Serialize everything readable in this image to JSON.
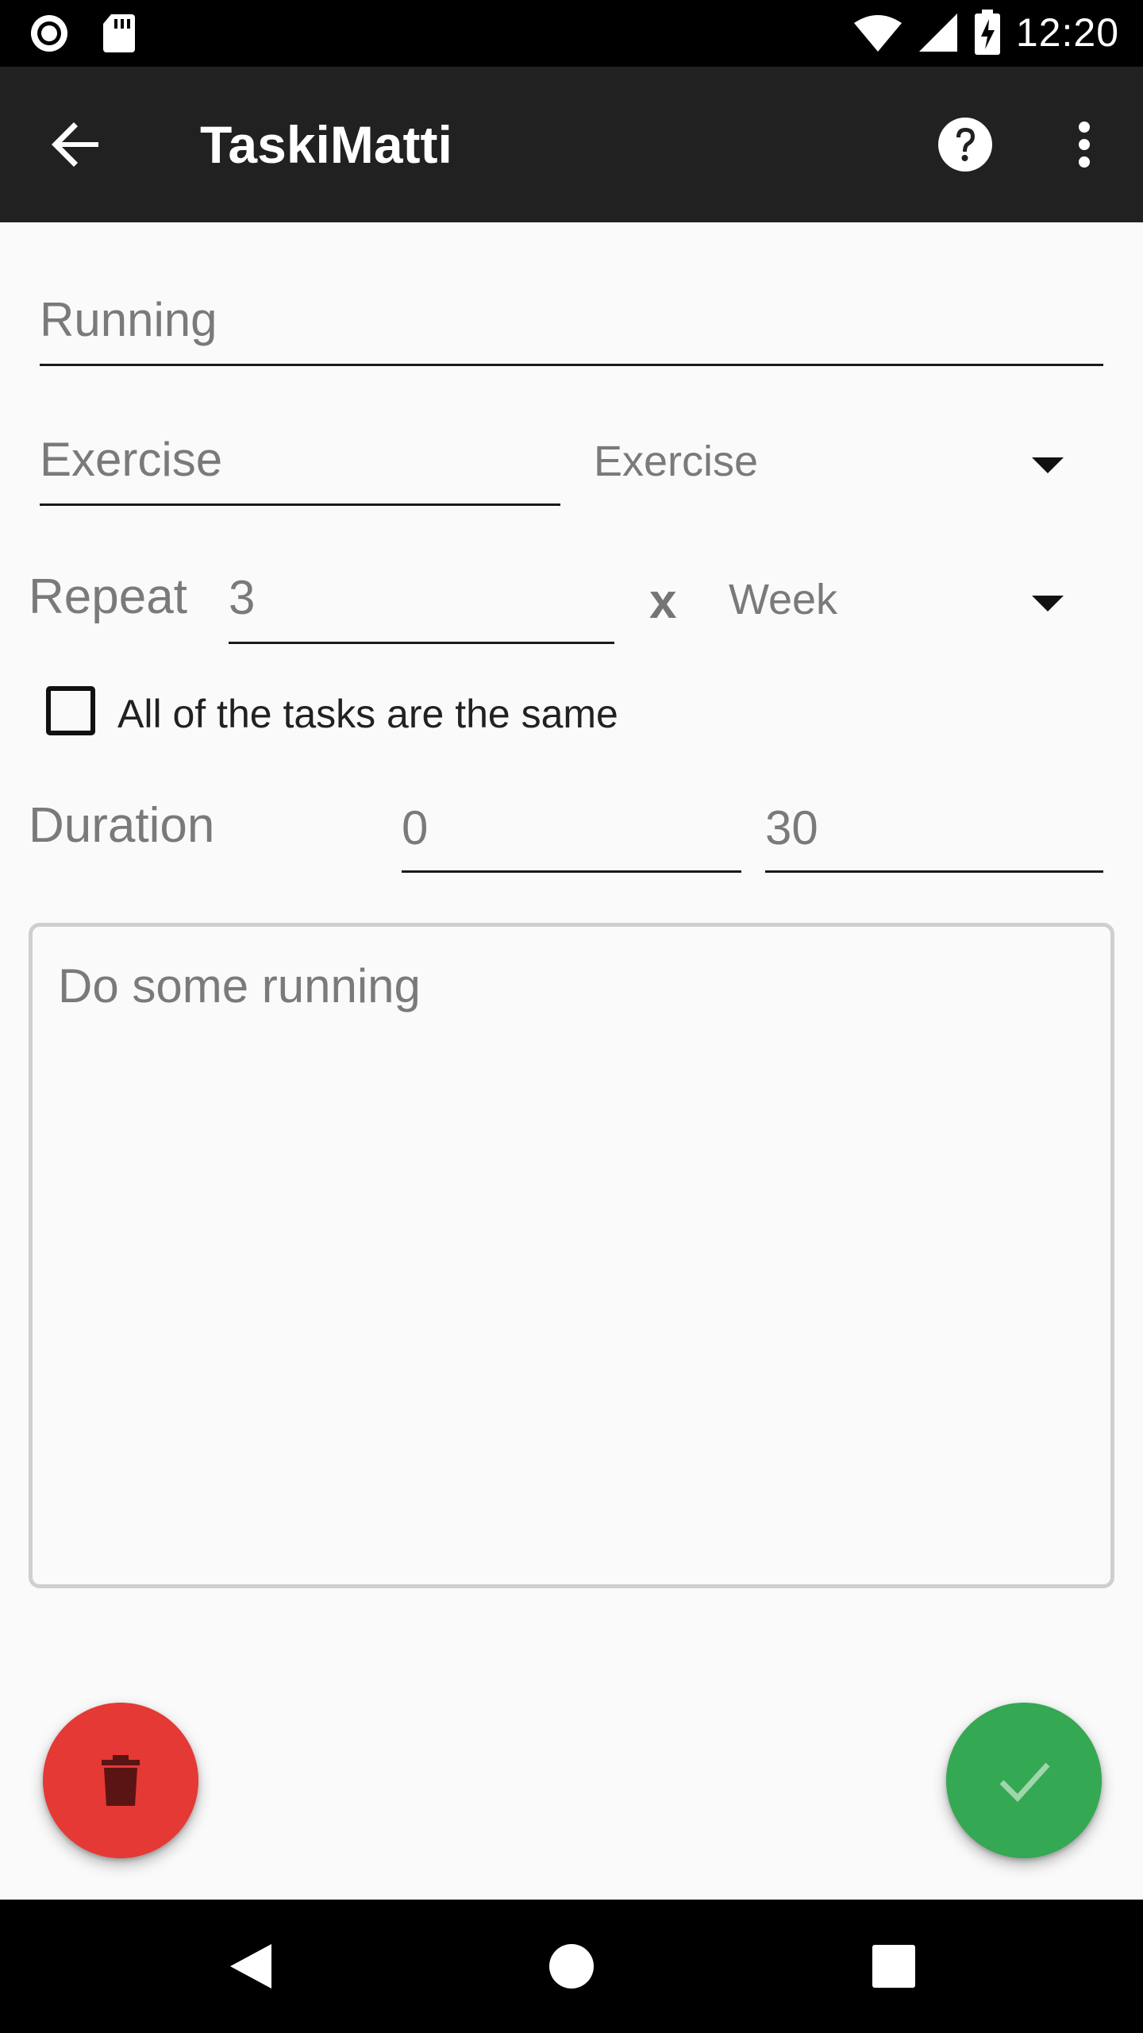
{
  "status_bar": {
    "time": "12:20",
    "icons": [
      "record-icon",
      "sd-card-icon",
      "wifi-icon",
      "signal-icon",
      "battery-charging-icon"
    ]
  },
  "app_bar": {
    "title": "TaskiMatti",
    "back_icon": "arrow-back-icon",
    "help_icon": "help-icon",
    "more_icon": "more-vert-icon"
  },
  "form": {
    "name": {
      "value": "Running"
    },
    "category": {
      "value": "Exercise"
    },
    "category_select": {
      "selected": "Exercise"
    },
    "repeat": {
      "label": "Repeat",
      "value": "3",
      "times_symbol": "x"
    },
    "period_select": {
      "selected": "Week"
    },
    "same_tasks": {
      "label": "All of the tasks are the same",
      "checked": false
    },
    "duration": {
      "label": "Duration",
      "hours": "0",
      "minutes": "30"
    },
    "description": {
      "value": "Do some running"
    }
  },
  "actions": {
    "delete_icon": "trash-icon",
    "save_icon": "check-icon",
    "delete_color": "#e53935",
    "save_color": "#34a853"
  },
  "nav_bar": {
    "icons": [
      "nav-back-icon",
      "nav-home-icon",
      "nav-recents-icon"
    ]
  }
}
